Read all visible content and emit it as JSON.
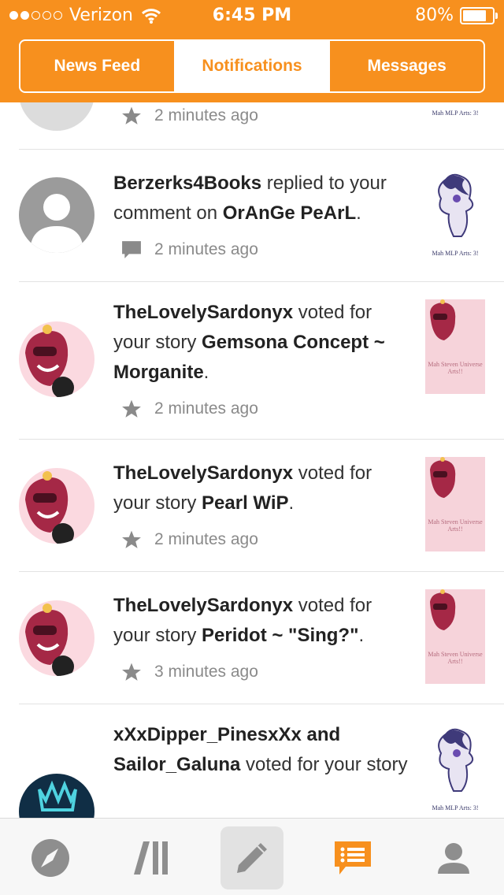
{
  "status_bar": {
    "carrier": "Verizon",
    "time": "6:45 PM",
    "battery": "80%",
    "battery_level": 0.8,
    "signal_bars_filled": 2,
    "signal_bars_total": 5
  },
  "tabs": [
    {
      "label": "News Feed",
      "active": false
    },
    {
      "label": "Notifications",
      "active": true
    },
    {
      "label": "Messages",
      "active": false
    }
  ],
  "notifications": [
    {
      "partial": true,
      "time": "2 minutes ago",
      "icon": "star-icon",
      "thumb_caption": "Mah MLP Arts: 3!"
    },
    {
      "user": "Berzerks4Books",
      "action": " replied to your comment on ",
      "target": "OrAnGe PeArL",
      "suffix": ".",
      "time": "2 minutes ago",
      "icon": "comment-icon",
      "thumb_caption": "Mah MLP Arts: 3!"
    },
    {
      "user": "TheLovelySardonyx",
      "action": " voted for your story ",
      "target": "Gemsona Concept ~ Morganite",
      "suffix": ".",
      "time": "2 minutes ago",
      "icon": "star-icon",
      "thumb_caption": "Mah Steven Universe Arts!!"
    },
    {
      "user": "TheLovelySardonyx",
      "action": " voted for your story ",
      "target": "Pearl WiP",
      "suffix": ".",
      "time": "2 minutes ago",
      "icon": "star-icon",
      "thumb_caption": "Mah Steven Universe Arts!!"
    },
    {
      "user": "TheLovelySardonyx",
      "action": " voted for your story ",
      "target": "Peridot ~ \"Sing?\"",
      "suffix": ".",
      "time": "3 minutes ago",
      "icon": "star-icon",
      "thumb_caption": "Mah Steven Universe Arts!!"
    },
    {
      "user": "xXxDipper_PinesxXx",
      "conjunction": " and ",
      "user2": "Sailor_Galuna",
      "action": " voted for your story",
      "thumb_caption": "Mah MLP Arts: 3!"
    }
  ],
  "bottom_nav": [
    {
      "icon": "compass-icon",
      "active": false
    },
    {
      "icon": "library-icon",
      "active": false
    },
    {
      "icon": "pencil-icon",
      "active": false,
      "highlighted": true
    },
    {
      "icon": "notifications-icon",
      "active": true
    },
    {
      "icon": "profile-icon",
      "active": false
    }
  ],
  "colors": {
    "accent": "#f7901e",
    "text": "#222222",
    "muted": "#8a8a8a",
    "icon_gray": "#9b9b9b"
  }
}
